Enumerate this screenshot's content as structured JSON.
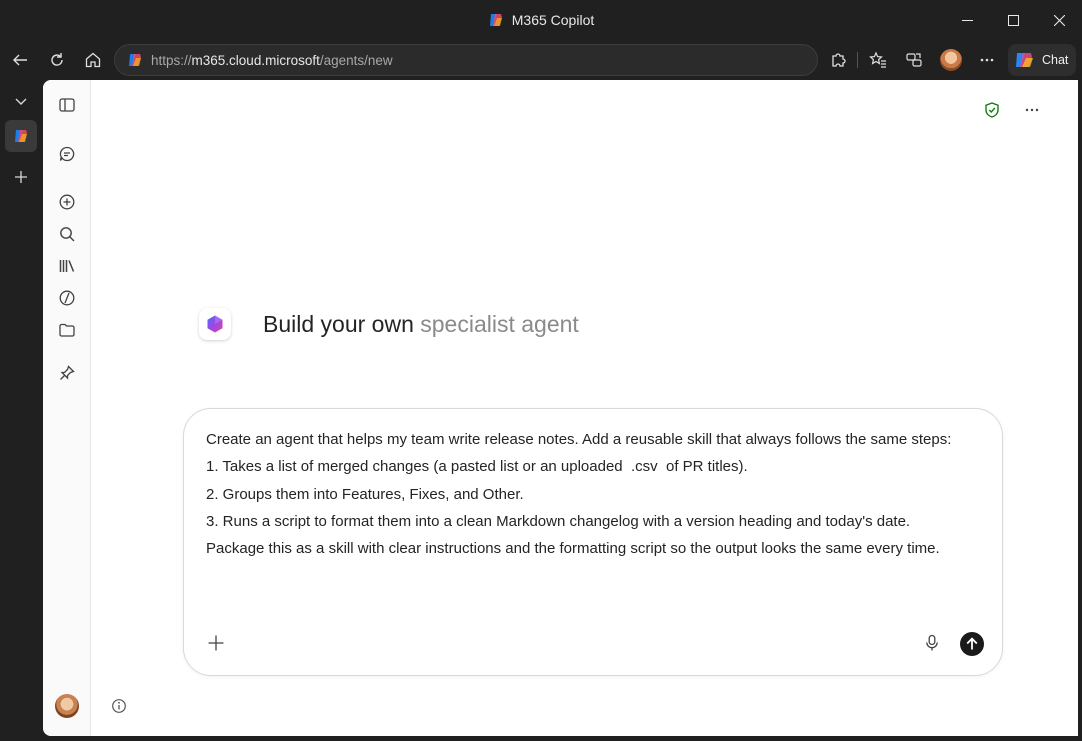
{
  "window": {
    "title": "M365 Copilot"
  },
  "toolbar": {
    "url_scheme": "https://",
    "url_host": "m365.cloud.microsoft",
    "url_path": "/agents/new",
    "chat_label": "Chat"
  },
  "page": {
    "hero": {
      "title_strong": "Build your own",
      "title_muted": "specialist agent"
    },
    "prompt_lines": [
      "Create an agent that helps my team write release notes. Add a reusable skill that always follows the same steps:",
      "1. Takes a list of merged changes (a pasted list or an uploaded  .csv  of PR titles).",
      "2. Groups them into Features, Fixes, and Other.",
      "3. Runs a script to format them into a clean Markdown changelog with a version heading and today's date.",
      "Package this as a skill with clear instructions and the formatting script so the output looks the same every time."
    ]
  },
  "colors": {
    "window_bg": "#202020",
    "page_bg": "#ffffff",
    "shield_green": "#107c10",
    "send_bg": "#1a1a1a"
  }
}
